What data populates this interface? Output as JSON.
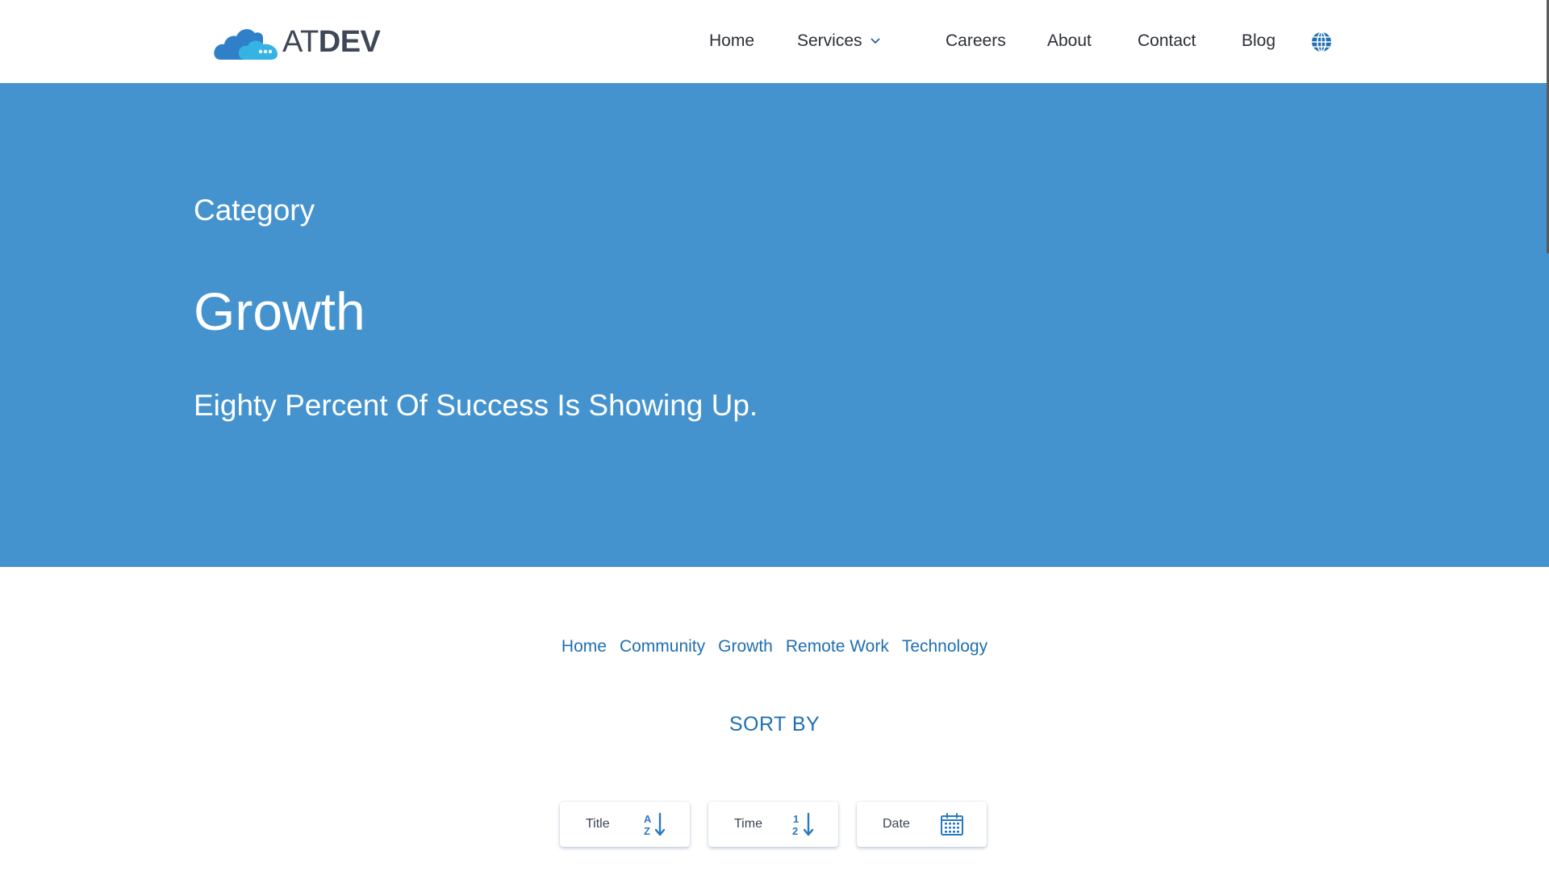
{
  "brand": {
    "logo_at": "AT",
    "logo_dev": "DEV"
  },
  "nav": {
    "home": "Home",
    "services": "Services",
    "careers": "Careers",
    "about": "About",
    "contact": "Contact",
    "blog": "Blog",
    "language_icon": "globe-icon"
  },
  "hero": {
    "category_label": "Category",
    "title": "Growth",
    "subtitle": "Eighty Percent Of Success Is Showing Up."
  },
  "categories": {
    "items": [
      "Home",
      "Community",
      "Growth",
      "Remote Work",
      "Technology"
    ]
  },
  "sort": {
    "heading": "SORT BY",
    "buttons": [
      {
        "label": "Title",
        "icon": "sort-alpha-down-icon"
      },
      {
        "label": "Time",
        "icon": "sort-numeric-down-icon"
      },
      {
        "label": "Date",
        "icon": "calendar-icon"
      }
    ]
  },
  "colors": {
    "hero_background": "#4493cf",
    "link_blue": "#1f6fb2",
    "logo_cloud_dark": "#2f80c8",
    "logo_cloud_light": "#35b3e3"
  }
}
